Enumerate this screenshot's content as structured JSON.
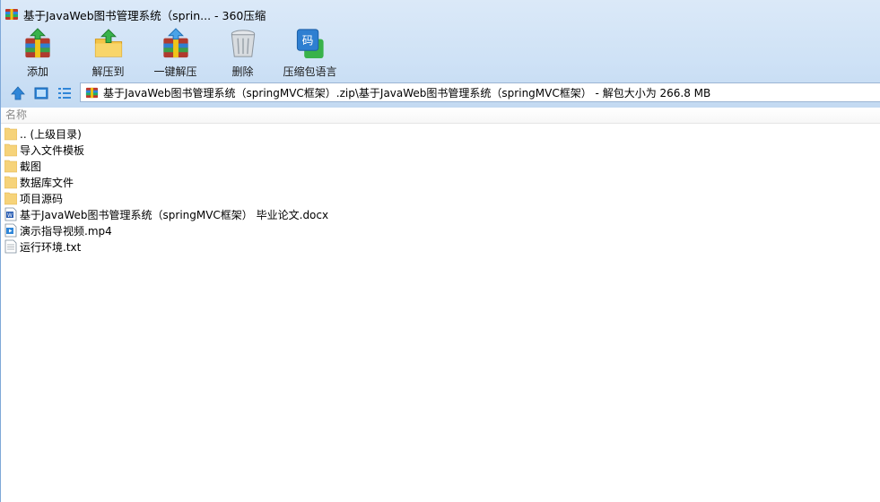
{
  "window": {
    "title": "基于JavaWeb图书管理系统（sprin... - 360压缩"
  },
  "toolbar": {
    "buttons": [
      {
        "label": "添加",
        "icon": "add-archive-icon"
      },
      {
        "label": "解压到",
        "icon": "extract-to-icon"
      },
      {
        "label": "一键解压",
        "icon": "one-click-extract-icon"
      },
      {
        "label": "删除",
        "icon": "delete-icon"
      },
      {
        "label": "压缩包语言",
        "icon": "archive-language-icon"
      }
    ]
  },
  "navbar": {
    "path": "基于JavaWeb图书管理系统（springMVC框架）.zip\\基于JavaWeb图书管理系统（springMVC框架） - 解包大小为 266.8 MB"
  },
  "filelist": {
    "column_name": "名称",
    "items": [
      {
        "name": ".. (上级目录)",
        "type": "folder"
      },
      {
        "name": "导入文件模板",
        "type": "folder"
      },
      {
        "name": "截图",
        "type": "folder"
      },
      {
        "name": "数据库文件",
        "type": "folder"
      },
      {
        "name": "项目源码",
        "type": "folder"
      },
      {
        "name": "基于JavaWeb图书管理系统（springMVC框架） 毕业论文.docx",
        "type": "word"
      },
      {
        "name": "演示指导视频.mp4",
        "type": "video"
      },
      {
        "name": "运行环境.txt",
        "type": "text"
      }
    ]
  },
  "colors": {
    "chrome_top": "#dbe9f8",
    "chrome_bottom": "#c3daf2",
    "folder": "#f6d37a",
    "nav_arrow": "#2f86d8"
  }
}
